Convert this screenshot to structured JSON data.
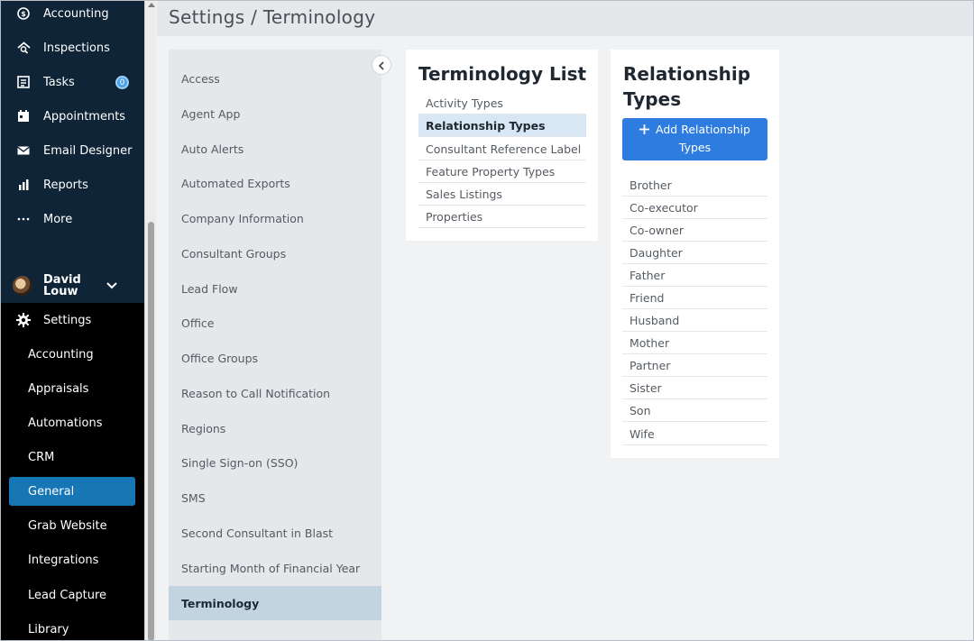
{
  "header": {
    "title": "Settings / Terminology"
  },
  "nav": {
    "items": [
      {
        "label": "Accounting",
        "icon": "dollar-circle-icon"
      },
      {
        "label": "Inspections",
        "icon": "inspection-icon"
      },
      {
        "label": "Tasks",
        "icon": "tasks-icon",
        "badge": "0"
      },
      {
        "label": "Appointments",
        "icon": "calendar-icon"
      },
      {
        "label": "Email Designer",
        "icon": "envelope-icon"
      },
      {
        "label": "Reports",
        "icon": "bar-chart-icon"
      },
      {
        "label": "More",
        "icon": "ellipsis-icon"
      }
    ],
    "user": {
      "name": "David Louw"
    },
    "settings_label": "Settings",
    "sub_items": [
      {
        "label": "Accounting"
      },
      {
        "label": "Appraisals"
      },
      {
        "label": "Automations"
      },
      {
        "label": "CRM"
      },
      {
        "label": "General",
        "active": true
      },
      {
        "label": "Grab Website"
      },
      {
        "label": "Integrations"
      },
      {
        "label": "Lead Capture"
      },
      {
        "label": "Library"
      }
    ]
  },
  "settings_menu": {
    "items": [
      "Access",
      "Agent App",
      "Auto Alerts",
      "Automated Exports",
      "Company Information",
      "Consultant Groups",
      "Lead Flow",
      "Office",
      "Office Groups",
      "Reason to Call Notification",
      "Regions",
      "Single Sign-on (SSO)",
      "SMS",
      "Second Consultant in Blast",
      "Starting Month of Financial Year",
      "Terminology"
    ],
    "active": "Terminology"
  },
  "terminology_list": {
    "title": "Terminology List",
    "items": [
      "Activity Types",
      "Relationship Types",
      "Consultant Reference Label",
      "Feature Property Types",
      "Sales Listings",
      "Properties"
    ],
    "active": "Relationship Types"
  },
  "relationship_types": {
    "title_line1": "Relationship",
    "title_line2": "Types",
    "add_button_line1": "Add Relationship",
    "add_button_line2": "Types",
    "items": [
      "Brother",
      "Co-executor",
      "Co-owner",
      "Daughter",
      "Father",
      "Friend",
      "Husband",
      "Mother",
      "Partner",
      "Sister",
      "Son",
      "Wife"
    ]
  },
  "colors": {
    "nav_bg": "#0f2437",
    "nav_bottom_bg": "#000000",
    "active_sub_item": "#1676b6",
    "primary_button": "#2f7ce0",
    "active_settings_item": "#c2d4df",
    "active_term_item": "#d9e6f4"
  }
}
